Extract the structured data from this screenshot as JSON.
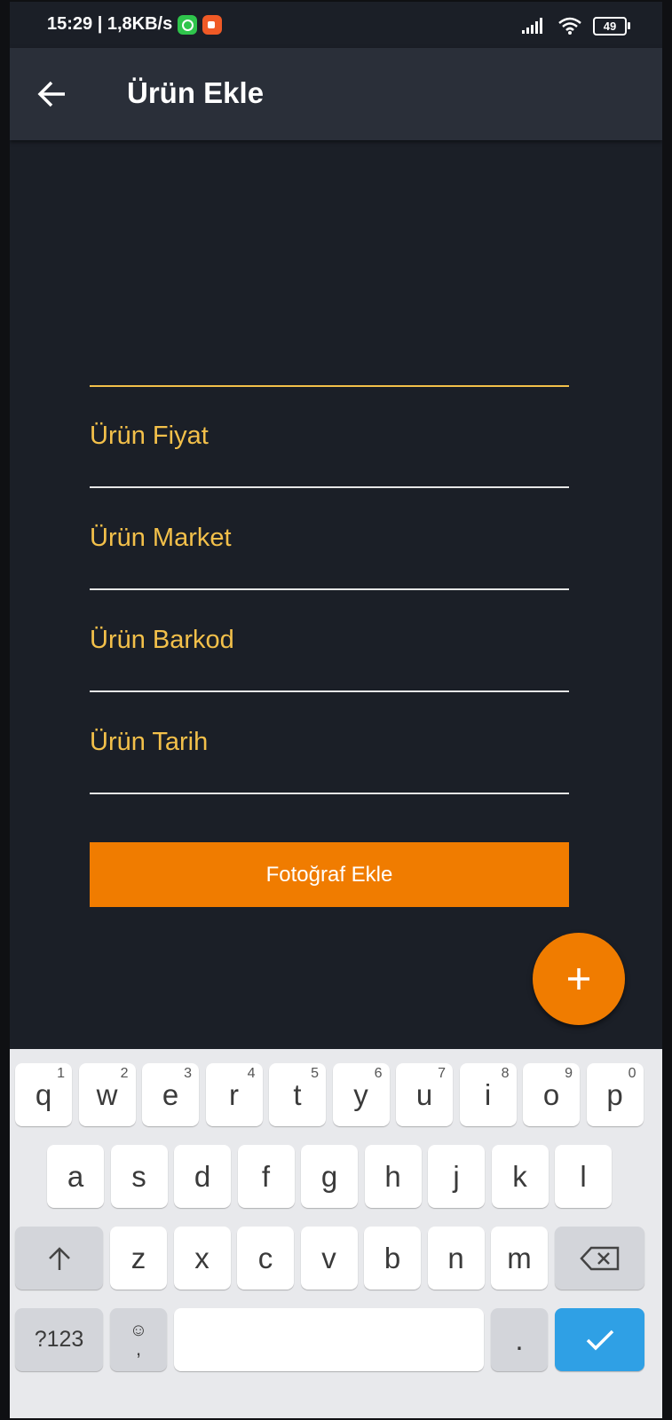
{
  "status_bar": {
    "time_and_speed": "15:29 | 1,8KB/s",
    "battery": "49"
  },
  "app_bar": {
    "title": "Ürün Ekle",
    "back_icon": "arrow-left-icon"
  },
  "form": {
    "fields": [
      {
        "label": ""
      },
      {
        "label": "Ürün Fiyat"
      },
      {
        "label": "Ürün Market"
      },
      {
        "label": "Ürün Barkod"
      },
      {
        "label": "Ürün Tarih"
      }
    ],
    "photo_button": "Fotoğraf Ekle"
  },
  "fab": {
    "icon": "plus-icon"
  },
  "keyboard": {
    "row1": [
      {
        "k": "q",
        "h": "1"
      },
      {
        "k": "w",
        "h": "2"
      },
      {
        "k": "e",
        "h": "3"
      },
      {
        "k": "r",
        "h": "4"
      },
      {
        "k": "t",
        "h": "5"
      },
      {
        "k": "y",
        "h": "6"
      },
      {
        "k": "u",
        "h": "7"
      },
      {
        "k": "i",
        "h": "8"
      },
      {
        "k": "o",
        "h": "9"
      },
      {
        "k": "p",
        "h": "0"
      }
    ],
    "row2": [
      "a",
      "s",
      "d",
      "f",
      "g",
      "h",
      "j",
      "k",
      "l"
    ],
    "row3": [
      "z",
      "x",
      "c",
      "v",
      "b",
      "n",
      "m"
    ],
    "symbols": "?123",
    "comma": ",",
    "period": "."
  },
  "colors": {
    "accent": "#f07c00",
    "label": "#f3c04a",
    "background": "#1b1f27",
    "appbar": "#2a2f39",
    "done": "#2fa0e5"
  }
}
